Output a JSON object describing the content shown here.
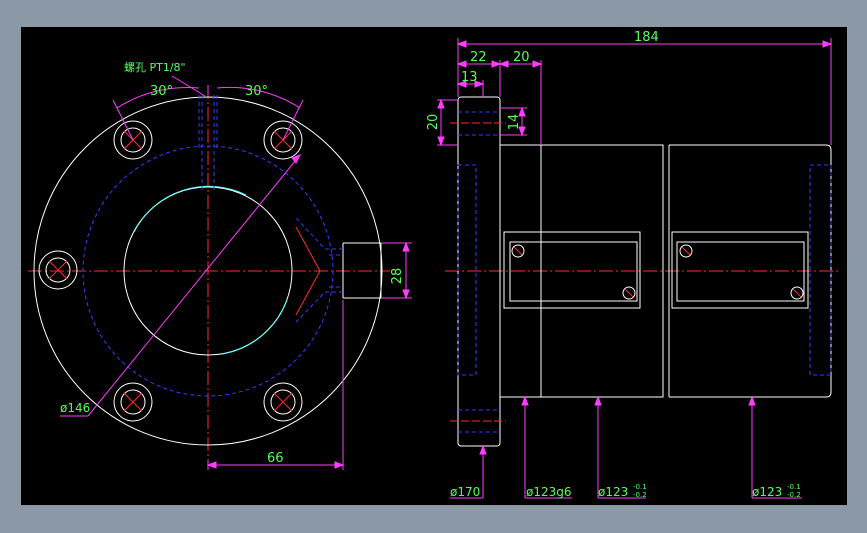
{
  "colors": {
    "background": "#8b98a6",
    "canvas": "#000000",
    "outline": "#ffffff",
    "hidden": "#3a3aff",
    "center": "#ff2a2a",
    "dimension": "#ff3cff",
    "text": "#55ff55",
    "bore_highlight": "#55ffff"
  },
  "left_view": {
    "thread_note": "螺孔 PT1/8\"",
    "angle_left": "30°",
    "angle_right": "30°",
    "dim_146": "ø146",
    "dim_66": "66",
    "dim_28": "28"
  },
  "right_view": {
    "dim_184": "184",
    "dim_22": "22",
    "dim_20_top": "20",
    "dim_13": "13",
    "dim_20_left": "20",
    "dim_14": "14",
    "dia_170": "ø170",
    "dia_123g6": "ø123g6",
    "dia_123a": "ø123",
    "tol_a_upper": "-0.1",
    "tol_a_lower": "-0.2",
    "dia_123b": "ø123",
    "tol_b_upper": "-0.1",
    "tol_b_lower": "-0.2"
  }
}
